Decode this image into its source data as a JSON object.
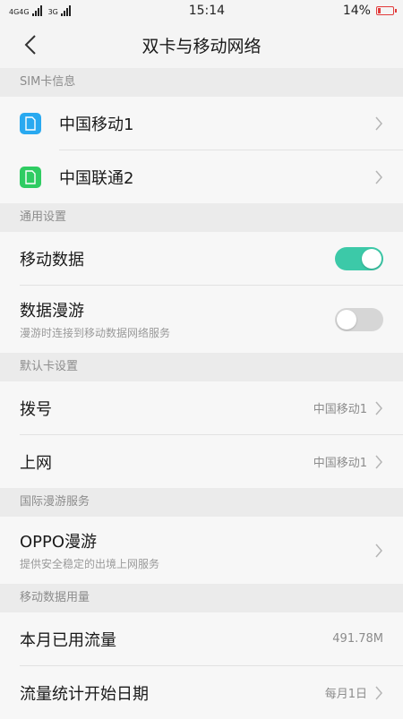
{
  "status_bar": {
    "network_left": "4G4G",
    "network_right": "3G",
    "time": "15:14",
    "battery_percent": "14%",
    "battery_level": 14
  },
  "app_bar": {
    "title": "双卡与移动网络"
  },
  "sections": {
    "sim": {
      "header": "SIM卡信息",
      "items": [
        {
          "label": "中国移动1",
          "badge": "1",
          "color": "#29a9f0"
        },
        {
          "label": "中国联通2",
          "badge": "2",
          "color": "#2fcc62"
        }
      ]
    },
    "general": {
      "header": "通用设置",
      "mobile_data": {
        "label": "移动数据",
        "on": true
      },
      "roaming": {
        "label": "数据漫游",
        "sub": "漫游时连接到移动数据网络服务",
        "on": false
      }
    },
    "default_card": {
      "header": "默认卡设置",
      "dial": {
        "label": "拨号",
        "value": "中国移动1"
      },
      "internet": {
        "label": "上网",
        "value": "中国移动1"
      }
    },
    "intl": {
      "header": "国际漫游服务",
      "oppo": {
        "label": "OPPO漫游",
        "sub": "提供安全稳定的出境上网服务"
      }
    },
    "usage": {
      "header": "移动数据用量",
      "month_used": {
        "label": "本月已用流量",
        "value": "491.78M"
      },
      "start_date": {
        "label": "流量统计开始日期",
        "value": "每月1日"
      }
    }
  },
  "colors": {
    "accent": "#3cc9a8",
    "toggle_off": "#d6d6d6"
  }
}
